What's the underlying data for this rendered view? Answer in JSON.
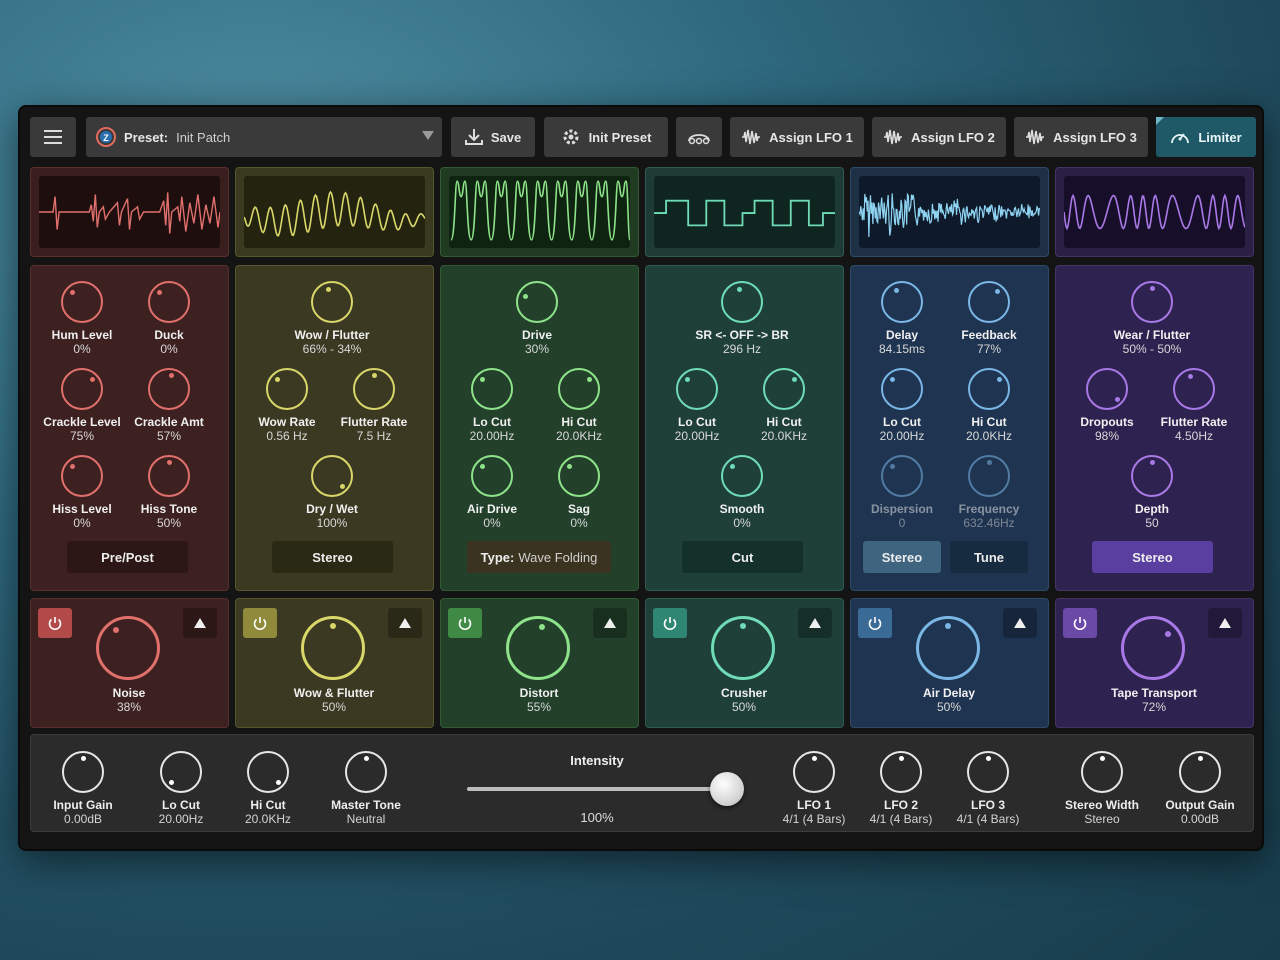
{
  "toolbar": {
    "preset_prefix": "Preset:",
    "preset_value": "Init Patch",
    "save_label": "Save",
    "init_label": "Init Preset",
    "lfo1_label": "Assign LFO 1",
    "lfo2_label": "Assign LFO 2",
    "lfo3_label": "Assign LFO 3",
    "limiter_label": "Limiter"
  },
  "colors": {
    "noise": "#e0706c",
    "wow": "#d9d66a",
    "distort": "#8ee38a",
    "crusher": "#6fdcb6",
    "delay": "#7ab6e6",
    "tape": "#a878e6"
  },
  "noise": {
    "hum_label": "Hum Level",
    "hum_value": "0%",
    "duck_label": "Duck",
    "duck_value": "0%",
    "crackle_level_label": "Crackle Level",
    "crackle_level_value": "75%",
    "crackle_amt_label": "Crackle Amt",
    "crackle_amt_value": "57%",
    "hiss_level_label": "Hiss Level",
    "hiss_level_value": "0%",
    "hiss_tone_label": "Hiss Tone",
    "hiss_tone_value": "50%",
    "button": "Pre/Post",
    "unit_label": "Noise",
    "unit_value": "38%"
  },
  "wow": {
    "wow_flutter_label": "Wow / Flutter",
    "wow_flutter_value": "66% - 34%",
    "wow_rate_label": "Wow Rate",
    "wow_rate_value": "0.56 Hz",
    "flutter_rate_label": "Flutter Rate",
    "flutter_rate_value": "7.5 Hz",
    "dry_wet_label": "Dry / Wet",
    "dry_wet_value": "100%",
    "button": "Stereo",
    "unit_label": "Wow & Flutter",
    "unit_value": "50%"
  },
  "distort": {
    "drive_label": "Drive",
    "drive_value": "30%",
    "locut_label": "Lo Cut",
    "locut_value": "20.00Hz",
    "hicut_label": "Hi Cut",
    "hicut_value": "20.0KHz",
    "air_label": "Air Drive",
    "air_value": "0%",
    "sag_label": "Sag",
    "sag_value": "0%",
    "type_prefix": "Type:",
    "type_value": "Wave Folding",
    "unit_label": "Distort",
    "unit_value": "55%"
  },
  "crusher": {
    "sr_label": "SR <- OFF -> BR",
    "sr_value": "296 Hz",
    "locut_label": "Lo Cut",
    "locut_value": "20.00Hz",
    "hicut_label": "Hi Cut",
    "hicut_value": "20.0KHz",
    "smooth_label": "Smooth",
    "smooth_value": "0%",
    "button": "Cut",
    "unit_label": "Crusher",
    "unit_value": "50%"
  },
  "delay": {
    "delay_label": "Delay",
    "delay_value": "84.15ms",
    "feedback_label": "Feedback",
    "feedback_value": "77%",
    "locut_label": "Lo Cut",
    "locut_value": "20.00Hz",
    "hicut_label": "Hi Cut",
    "hicut_value": "20.0KHz",
    "dispersion_label": "Dispersion",
    "dispersion_value": "0",
    "frequency_label": "Frequency",
    "frequency_value": "632.46Hz",
    "stereo_button": "Stereo",
    "tune_button": "Tune",
    "unit_label": "Air Delay",
    "unit_value": "50%"
  },
  "tape": {
    "wear_label": "Wear / Flutter",
    "wear_value": "50% - 50%",
    "dropouts_label": "Dropouts",
    "dropouts_value": "98%",
    "flutter_rate_label": "Flutter Rate",
    "flutter_rate_value": "4.50Hz",
    "depth_label": "Depth",
    "depth_value": "50",
    "button": "Stereo",
    "unit_label": "Tape Transport",
    "unit_value": "72%"
  },
  "footer": {
    "input_gain_label": "Input Gain",
    "input_gain_value": "0.00dB",
    "locut_label": "Lo Cut",
    "locut_value": "20.00Hz",
    "hicut_label": "Hi Cut",
    "hicut_value": "20.0KHz",
    "master_tone_label": "Master Tone",
    "master_tone_value": "Neutral",
    "intensity_label": "Intensity",
    "intensity_value": "100%",
    "intensity_level": 1.0,
    "lfo1_label": "LFO 1",
    "lfo1_value": "4/1 (4 Bars)",
    "lfo2_label": "LFO 2",
    "lfo2_value": "4/1 (4 Bars)",
    "lfo3_label": "LFO 3",
    "lfo3_value": "4/1 (4 Bars)",
    "stereo_width_label": "Stereo Width",
    "stereo_width_value": "Stereo",
    "output_gain_label": "Output Gain",
    "output_gain_value": "0.00dB"
  }
}
